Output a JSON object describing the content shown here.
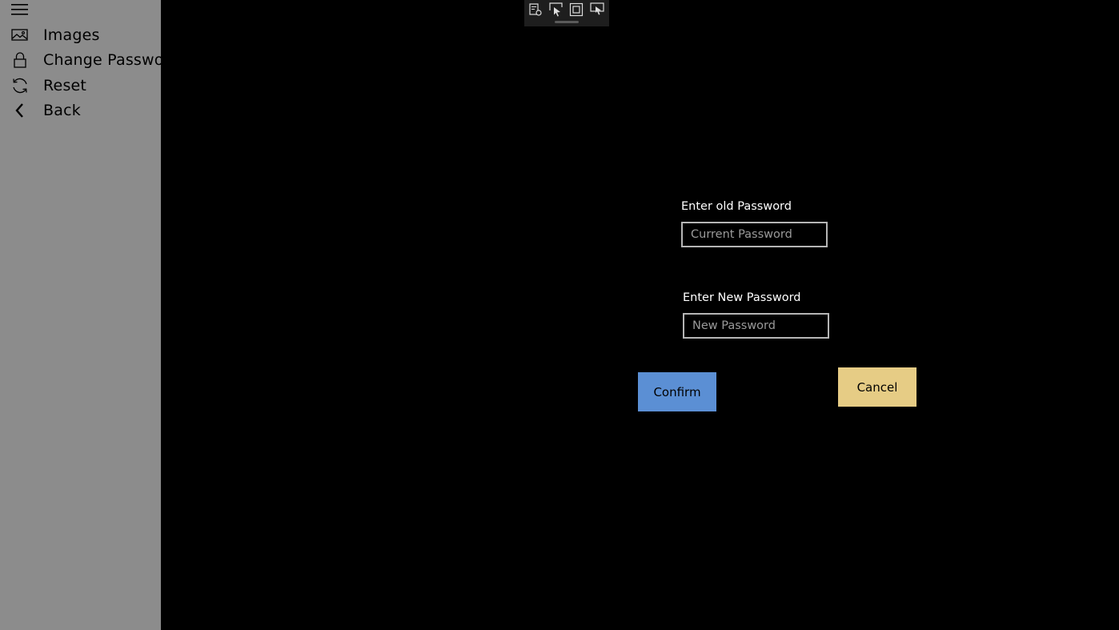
{
  "sidebar": {
    "items": [
      {
        "label": "Images",
        "icon": "image-icon"
      },
      {
        "label": "Change Password",
        "icon": "lock-icon"
      },
      {
        "label": "Reset",
        "icon": "refresh-icon"
      },
      {
        "label": "Back",
        "icon": "chevron-left-icon"
      }
    ]
  },
  "toolbar": {
    "icons": [
      "inspect-properties-icon",
      "select-element-icon",
      "layout-bounds-icon",
      "track-focus-icon"
    ]
  },
  "form": {
    "old_password": {
      "label": "Enter old Password",
      "placeholder": "Current Password",
      "value": ""
    },
    "new_password": {
      "label": "Enter New Password",
      "placeholder": "New Password",
      "value": ""
    },
    "confirm_label": "Confirm",
    "cancel_label": "Cancel"
  },
  "colors": {
    "sidebar_bg": "#8c8c8c",
    "content_bg": "#000000",
    "confirm_bg": "#5b8fd4",
    "cancel_bg": "#e6cc85",
    "toolbar_bg": "#1e1e1e"
  }
}
